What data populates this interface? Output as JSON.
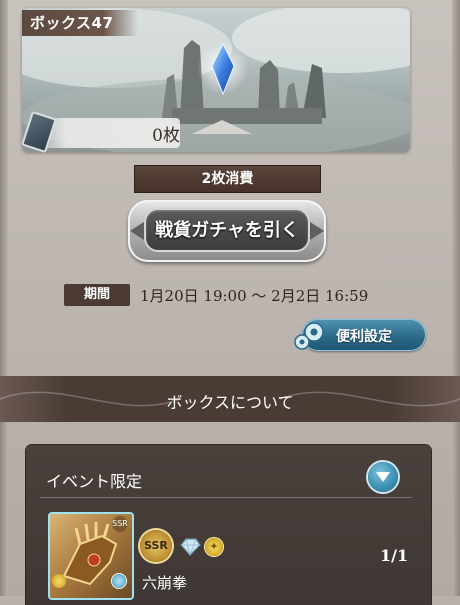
{
  "box": {
    "title": "ボックス47",
    "ticket_count": "0枚"
  },
  "gacha": {
    "cost_label": "2枚消費",
    "draw_button_label": "戦貨ガチャを引く"
  },
  "period": {
    "badge": "期間",
    "range": "1月20日 19:00 〜 2月2日 16:59"
  },
  "settings": {
    "button_label": "便利設定"
  },
  "section": {
    "header": "ボックスについて"
  },
  "panel": {
    "title": "イベント限定",
    "items": [
      {
        "rarity": "SSR",
        "name": "六崩拳",
        "count": "1/1"
      }
    ]
  }
}
